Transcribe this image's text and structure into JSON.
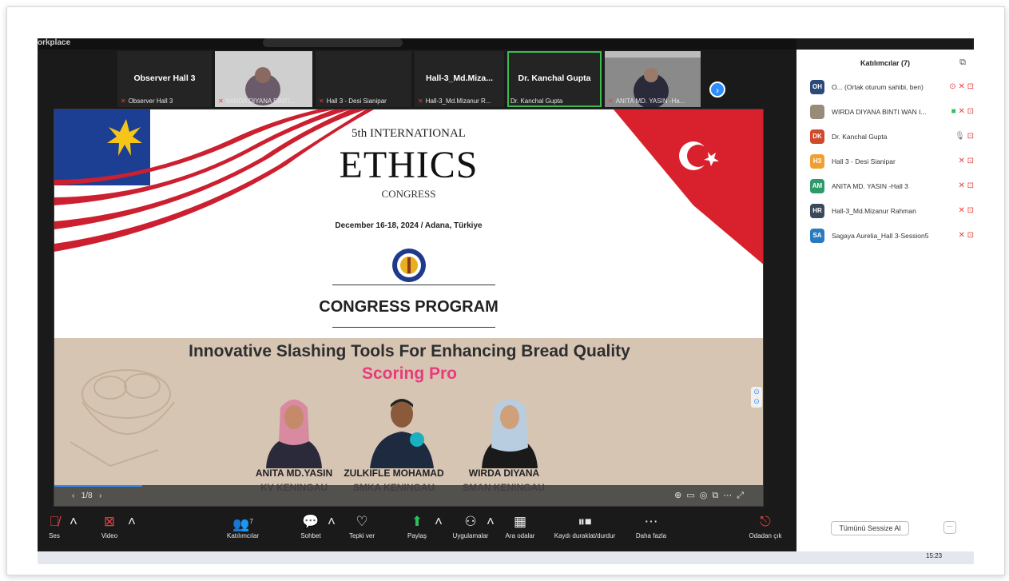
{
  "window": {
    "title": "orkplace"
  },
  "video_strip": {
    "tiles": [
      {
        "name": "Observer Hall 3",
        "label": "Observer Hall 3",
        "has_video": false,
        "active": false
      },
      {
        "name": "",
        "label": "WIRDA DIYANA BINTI...",
        "has_video": true,
        "active": false
      },
      {
        "name": "",
        "label": "Hall 3 - Desi Sianipar",
        "has_video": false,
        "active": false
      },
      {
        "name": "Hall-3_Md.Miza...",
        "label": "Hall-3_Md.Mizanur R...",
        "has_video": false,
        "active": false
      },
      {
        "name": "Dr. Kanchal Gupta",
        "label": "Dr. Kanchal Gupta",
        "has_video": false,
        "active": true
      },
      {
        "name": "",
        "label": "ANITA MD. YASIN -Ha...",
        "has_video": true,
        "active": false
      }
    ],
    "next_icon": "chevron-right-icon"
  },
  "slide": {
    "edition": "5th INTERNATIONAL",
    "title": "ETHICS",
    "subtitle": "CONGRESS",
    "dates": "December 16-18, 2024 / Adana, Türkiye",
    "program": "CONGRESS PROGRAM",
    "headline": "Innovative Slashing Tools For Enhancing Bread Quality",
    "product": "Scoring  Pro",
    "people": [
      {
        "name": "ANITA MD.YASIN",
        "school": "KV KENINGAU"
      },
      {
        "name": "ZULKIFLE  MOHAMAD",
        "school": "SMKA KENINGAU"
      },
      {
        "name": "WIRDA DIYANA",
        "school": "SMAN KENINGAU"
      }
    ],
    "page": "1/8"
  },
  "toolbar": {
    "audio": "Ses",
    "video": "Video",
    "participants": "Katılımcılar",
    "participants_count": "7",
    "chat": "Sohbet",
    "react": "Tepki ver",
    "share": "Paylaş",
    "apps": "Uygulamalar",
    "breakout": "Ara odalar",
    "record": "Kaydı duraklat/durdur",
    "more": "Daha fazla",
    "leave": "Odadan çık"
  },
  "participants_panel": {
    "title": "Katılımcılar (7)",
    "items": [
      {
        "initials": "OH",
        "name": "O... (Ortak oturum sahibi, ben)",
        "color": "#2b4a7a"
      },
      {
        "initials": "",
        "name": "WIRDA DIYANA BINTI WAN I...",
        "color": "#9a8a7a"
      },
      {
        "initials": "DK",
        "name": "Dr. Kanchal Gupta",
        "color": "#d04a2c"
      },
      {
        "initials": "H3",
        "name": "Hall 3 - Desi Sianipar",
        "color": "#f0a030"
      },
      {
        "initials": "AM",
        "name": "ANITA MD. YASIN -Hall 3",
        "color": "#2e9a6a"
      },
      {
        "initials": "HR",
        "name": "Hall-3_Md.Mizanur Rahman",
        "color": "#3a4a5a"
      },
      {
        "initials": "SA",
        "name": "Sagaya Aurelia_Hall 3-Session5",
        "color": "#2b7abf"
      }
    ],
    "mute_all": "Tümünü Sessize Al",
    "more": "···"
  },
  "taskbar": {
    "time": "15:23"
  }
}
